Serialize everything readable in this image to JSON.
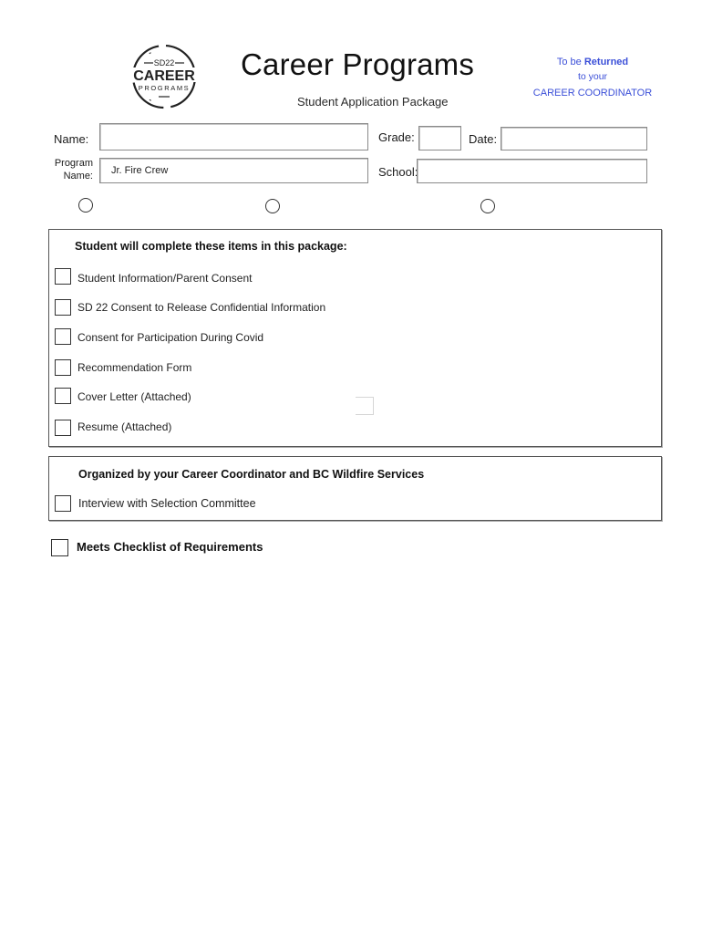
{
  "logo": {
    "icon": "sd22-career-programs-logo",
    "line1": "SD22",
    "line2": "CAREER",
    "line3": "PROGRAMS"
  },
  "header": {
    "title": "Career Programs",
    "subtitle": "Student Application Package",
    "return_note": {
      "prefix": "To be ",
      "emphasis": "Returned",
      "line2": "to your",
      "line3": "CAREER COORDINATOR",
      "color": "#3b4fd8"
    }
  },
  "form": {
    "name": {
      "label": "Name:",
      "value": ""
    },
    "grade": {
      "label": "Grade:",
      "value": ""
    },
    "date": {
      "label": "Date:",
      "value": ""
    },
    "program_name": {
      "label_line1": "Program",
      "label_line2": "Name:",
      "value": "Jr. Fire Crew"
    },
    "school": {
      "label": "School:",
      "value": ""
    },
    "radio_options": [
      {
        "selected": false
      },
      {
        "selected": false
      },
      {
        "selected": false
      }
    ]
  },
  "student_section": {
    "title": "Student will complete these items in this package:",
    "items": [
      {
        "label": "Student Information/Parent Consent",
        "checked": false
      },
      {
        "label": "SD 22 Consent to Release Confidential Information",
        "checked": false
      },
      {
        "label": "Consent for Participation During Covid",
        "checked": false
      },
      {
        "label": "Recommendation Form",
        "checked": false
      },
      {
        "label": "Cover Letter (Attached)",
        "checked": false
      },
      {
        "label": "Resume (Attached)",
        "checked": false
      }
    ]
  },
  "coordinator_section": {
    "title": "Organized by your Career Coordinator and BC Wildfire Services",
    "items": [
      {
        "label": "Interview with Selection Committee",
        "checked": false
      }
    ]
  },
  "final_check": {
    "label": "Meets Checklist of Requirements",
    "checked": false
  }
}
